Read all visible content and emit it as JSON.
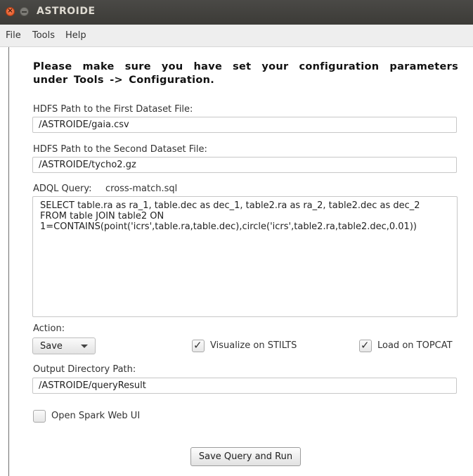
{
  "window": {
    "title": "ASTROIDE"
  },
  "menu": {
    "items": [
      "File",
      "Tools",
      "Help"
    ]
  },
  "notice": "Please make sure you have set your configuration parameters under Tools -> Configuration.",
  "dataset1": {
    "label": "HDFS Path to the First Dataset File:",
    "value": "/ASTROIDE/gaia.csv"
  },
  "dataset2": {
    "label": "HDFS Path to the Second Dataset File:",
    "value": "/ASTROIDE/tycho2.gz"
  },
  "query": {
    "label": "ADQL Query:",
    "file": "cross-match.sql",
    "text": "SELECT table.ra as ra_1, table.dec as dec_1, table2.ra as ra_2, table2.dec as dec_2\nFROM table JOIN table2 ON\n1=CONTAINS(point('icrs',table.ra,table.dec),circle('icrs',table2.ra,table2.dec,0.01))"
  },
  "action": {
    "label": "Action:",
    "selected": "Save",
    "visualize": {
      "label": "Visualize on STILTS",
      "checked": true
    },
    "topcat": {
      "label": "Load on TOPCAT",
      "checked": true
    }
  },
  "output": {
    "label": "Output Directory Path:",
    "value": "/ASTROIDE/queryResult"
  },
  "spark": {
    "label": "Open Spark Web UI",
    "checked": false
  },
  "run_button": "Save Query and Run",
  "icons": {
    "close": "close-icon",
    "minimize": "minimize-icon",
    "dropdown": "chevron-down-icon",
    "check": "check-icon"
  }
}
